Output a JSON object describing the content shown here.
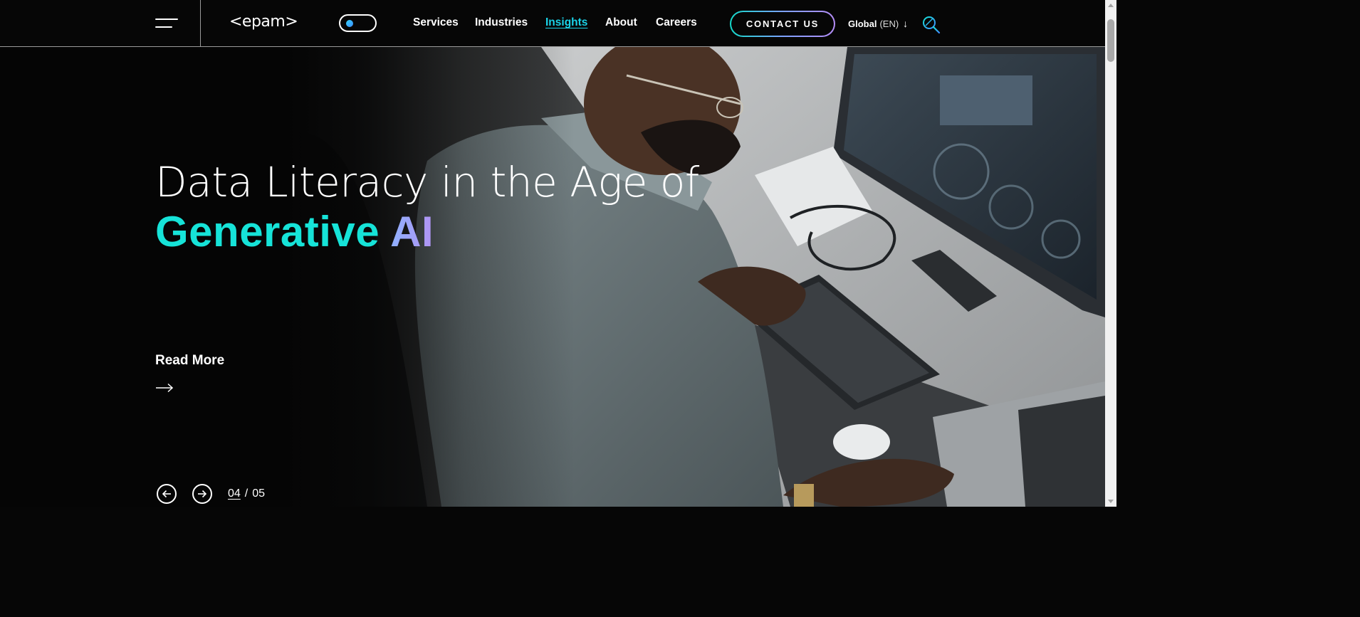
{
  "header": {
    "logo_text": "<epam>",
    "nav": [
      {
        "label": "Services",
        "active": false
      },
      {
        "label": "Industries",
        "active": false
      },
      {
        "label": "Insights",
        "active": true
      },
      {
        "label": "About",
        "active": false
      },
      {
        "label": "Careers",
        "active": false
      }
    ],
    "contact_label": "CONTACT US",
    "language": {
      "region": "Global",
      "code": "(EN)"
    }
  },
  "hero": {
    "title_line1": "Data Literacy in the Age of",
    "title_line2_part1": "Generative",
    "title_line2_part2": "AI",
    "read_more": "Read More",
    "slide_current": "04",
    "slide_separator": "/",
    "slide_total": "05"
  },
  "colors": {
    "accent_teal": "#16e3d8",
    "accent_purple": "#b193f2",
    "background": "#060606"
  },
  "icons": [
    "menu-icon",
    "theme-toggle",
    "chevron-down-icon",
    "search-icon",
    "arrow-right-icon",
    "arrow-left-icon"
  ]
}
